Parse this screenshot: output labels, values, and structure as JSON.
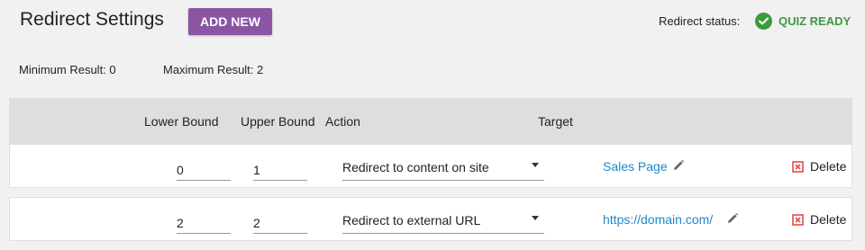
{
  "header": {
    "title": "Redirect Settings",
    "add_new_label": "ADD NEW",
    "status_label": "Redirect status:",
    "status_value": "QUIZ READY",
    "status_icon": "check-circle-icon",
    "status_color": "#3c9b3c",
    "accent_color": "#8a56a3"
  },
  "results": {
    "minimum_label": "Minimum Result: 0",
    "maximum_label": "Maximum Result: 2"
  },
  "table": {
    "columns": [
      "Lower Bound",
      "Upper Bound",
      "Action",
      "Target"
    ],
    "rows": [
      {
        "lower": "0",
        "upper": "1",
        "action": "Redirect to content on site",
        "target": "Sales Page",
        "delete_label": "Delete"
      },
      {
        "lower": "2",
        "upper": "2",
        "action": "Redirect to external URL",
        "target": "https://domain.com/",
        "delete_label": "Delete"
      }
    ]
  },
  "link_color": "#1e88c8",
  "delete_icon_color": "#e84b4b"
}
